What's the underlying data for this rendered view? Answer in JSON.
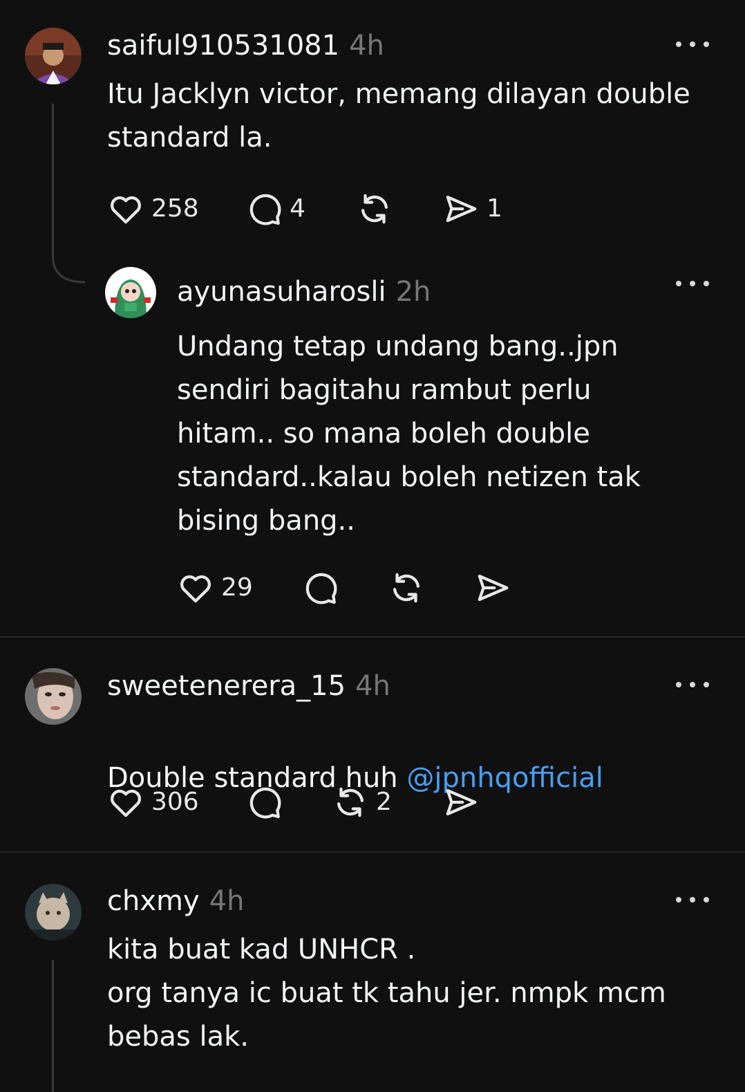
{
  "posts": [
    {
      "username": "saiful910531081",
      "time": "4h",
      "text": "Itu Jacklyn victor, memang dilayan double\nstandard la.",
      "likes": "258",
      "replies": "4",
      "reposts": "",
      "shares": "1",
      "avatar_icon": "profile-photo",
      "reply": {
        "username": "ayunasuharosli",
        "time": "2h",
        "text": "Undang tetap undang bang..jpn\nsendiri bagitahu rambut perlu\nhitam.. so mana boleh double\nstandard..kalau boleh netizen tak\nbising bang..",
        "likes": "29",
        "replies": "",
        "reposts": "",
        "shares": "",
        "avatar_icon": "cartoon-hijab-avatar"
      }
    },
    {
      "username": "sweetenerera_15",
      "time": "4h",
      "text_plain": "Double standard huh ",
      "mention": "@jpnhqofficial",
      "likes": "306",
      "replies": "",
      "reposts": "2",
      "shares": "",
      "avatar_icon": "profile-photo"
    },
    {
      "username": "chxmy",
      "time": "4h",
      "text": "kita buat kad UNHCR .\norg tanya ic buat tk tahu jer. nmpk mcm\nbebas lak.",
      "avatar_icon": "profile-photo"
    }
  ],
  "icons": {
    "like": "heart-icon",
    "reply": "comment-bubble-icon",
    "repost": "repost-arrows-icon",
    "share": "send-icon",
    "more": "more-dots-icon"
  },
  "colors": {
    "background": "#101010",
    "text": "#f3f5f7",
    "muted": "#777777",
    "mention": "#4a9ef4"
  }
}
